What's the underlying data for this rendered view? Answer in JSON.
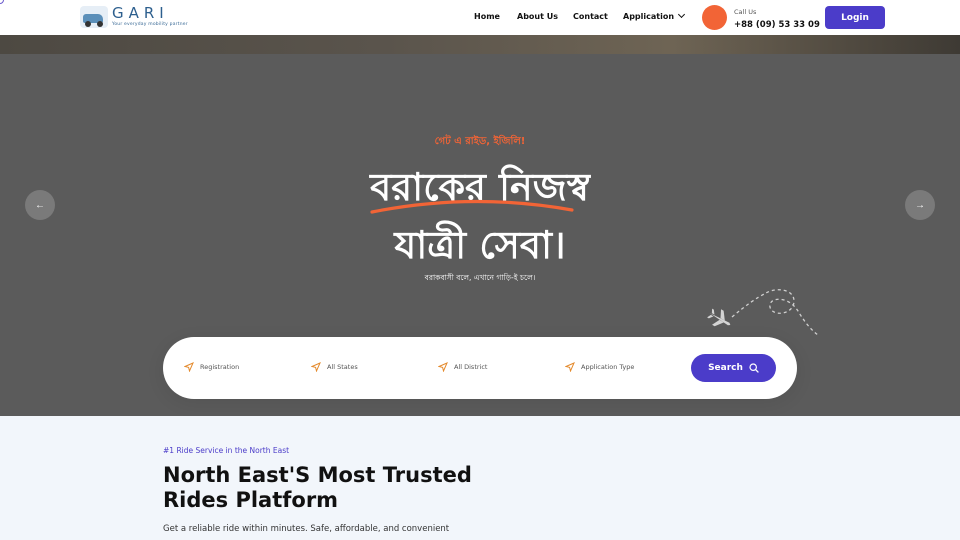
{
  "header": {
    "logo_name": "GARI",
    "logo_tagline": "Your everyday mobility partner",
    "nav": [
      {
        "label": "Home"
      },
      {
        "label": "About Us"
      },
      {
        "label": "Contact"
      },
      {
        "label": "Application",
        "icon": "chevron-down-icon"
      }
    ],
    "call": {
      "label": "Call Us",
      "number": "+88 (09) 53 33 09"
    },
    "login_label": "Login"
  },
  "hero": {
    "kicker": "গেট এ রাইড, ইজিলি!",
    "headline_line1": "বরাকের নিজস্ব",
    "headline_line2": "যাত্রী সেবা।",
    "subtext": "বরাকবাসী বলে, এখানে গাড়ি-ই চলে।",
    "prev_icon": "arrow-left-icon",
    "next_icon": "arrow-right-icon",
    "prev_label": "←",
    "next_label": "→"
  },
  "search": {
    "fields": [
      {
        "label": "Registration",
        "icon": "send-icon"
      },
      {
        "label": "All States",
        "icon": "send-icon"
      },
      {
        "label": "All District",
        "icon": "send-icon"
      },
      {
        "label": "Application Type",
        "icon": "send-icon"
      }
    ],
    "button_label": "Search"
  },
  "about": {
    "kicker": "#1 Ride Service in the North East",
    "title_line1": "North East'S Most Trusted",
    "title_line2": "Rides Platform",
    "description": "Get a reliable ride within minutes. Safe, affordable, and convenient"
  },
  "colors": {
    "accent": "#4b3cc9",
    "orange": "#f26436",
    "hero_bg": "#5b5b5b",
    "about_bg": "#f2f6fb"
  }
}
